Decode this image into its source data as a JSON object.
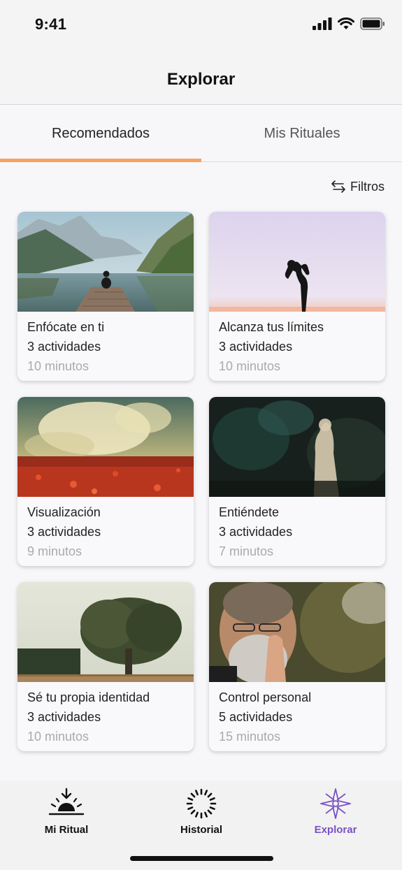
{
  "status_bar": {
    "time": "9:41"
  },
  "header": {
    "title": "Explorar"
  },
  "tabs": [
    {
      "label": "Recomendados",
      "active": true
    },
    {
      "label": "Mis Rituales",
      "active": false
    }
  ],
  "filters": {
    "label": "Filtros",
    "icon": "swap-arrows-icon"
  },
  "cards": [
    {
      "title": "Enfócate en ti",
      "activities": "3 actividades",
      "duration": "10 minutos",
      "image": "lake-mountains-meditation"
    },
    {
      "title": "Alcanza tus límites",
      "activities": "3 actividades",
      "duration": "10 minutos",
      "image": "yoga-silhouette-pink-sky"
    },
    {
      "title": "Visualización",
      "activities": "3 actividades",
      "duration": "9 minutos",
      "image": "red-flower-field-abstract"
    },
    {
      "title": "Entiéndete",
      "activities": "3 actividades",
      "duration": "7 minutos",
      "image": "statue-dark-forest"
    },
    {
      "title": "Sé tu propia identidad",
      "activities": "3 actividades",
      "duration": "10 minutos",
      "image": "large-tree-field"
    },
    {
      "title": "Control personal",
      "activities": "5 actividades",
      "duration": "15 minutos",
      "image": "praying-man-portrait"
    }
  ],
  "tabbar": [
    {
      "label": "Mi Ritual",
      "icon": "sunrise-icon",
      "active": false
    },
    {
      "label": "Historial",
      "icon": "circle-dashes-icon",
      "active": false
    },
    {
      "label": "Explorar",
      "icon": "compass-star-icon",
      "active": true
    }
  ],
  "colors": {
    "accent_orange": "#f6a15f",
    "active_purple": "#7a52c4",
    "muted_text": "#aaaaaa"
  }
}
